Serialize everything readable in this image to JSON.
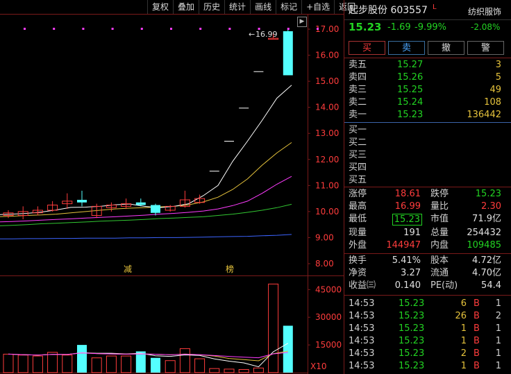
{
  "toolbar": [
    "复权",
    "叠加",
    "历史",
    "统计",
    "画线",
    "标记",
    "+自选",
    "返回"
  ],
  "chart": {
    "high_label": "16.99",
    "price_ticks": [
      "17.00",
      "16.00",
      "15.00",
      "14.00",
      "13.00",
      "12.00",
      "11.00",
      "10.00",
      "9.00",
      "8.00"
    ],
    "vol_ticks": [
      "45000",
      "30000",
      "15000"
    ],
    "vol_unit": "X10",
    "markers": [
      "减",
      "榜"
    ],
    "colors": {
      "up": "#ff3c3c",
      "down": "#54ffff",
      "ma5": "#ffffff",
      "ma10": "#e6c33c",
      "ma20": "#ff3cff",
      "ma30": "#32c832",
      "ma60": "#3c64ff"
    }
  },
  "header": {
    "name": "起步股份 603557",
    "flag": "L",
    "industry": "纺织服饰",
    "industry_change": "-2.08%",
    "price": "15.23",
    "change": "-1.69",
    "pct": "-9.99%"
  },
  "buttons": {
    "buy": "买",
    "sell": "卖",
    "cancel": "撤",
    "alert": "警"
  },
  "asks": [
    {
      "label": "卖五",
      "price": "15.27",
      "vol": "3"
    },
    {
      "label": "卖四",
      "price": "15.26",
      "vol": "5"
    },
    {
      "label": "卖三",
      "price": "15.25",
      "vol": "49"
    },
    {
      "label": "卖二",
      "price": "15.24",
      "vol": "108"
    },
    {
      "label": "卖一",
      "price": "15.23",
      "vol": "136442"
    }
  ],
  "bids": [
    {
      "label": "买一"
    },
    {
      "label": "买二"
    },
    {
      "label": "买三"
    },
    {
      "label": "买四"
    },
    {
      "label": "买五"
    }
  ],
  "quote": {
    "zt_l": "涨停",
    "zt_v": "18.61",
    "dt_l": "跌停",
    "dt_v": "15.23",
    "hi_l": "最高",
    "hi_v": "16.99",
    "lb_l": "量比",
    "lb_v": "2.30",
    "lo_l": "最低",
    "lo_v": "15.23",
    "sz_l": "市值",
    "sz_v": "71.9亿",
    "xl_l": "现量",
    "xl_v": "191",
    "zl_l": "总量",
    "zl_v": "254432",
    "wp_l": "外盘",
    "wp_v": "144947",
    "np_l": "内盘",
    "np_v": "109485"
  },
  "fin": {
    "hs_l": "换手",
    "hs_v": "5.41%",
    "gb_l": "股本",
    "gb_v": "4.72亿",
    "jz_l": "净资",
    "jz_v": "3.27",
    "lt_l": "流通",
    "lt_v": "4.70亿",
    "sy_l": "收益㈢",
    "sy_v": "0.140",
    "pe_l": "PE(动)",
    "pe_v": "54.4"
  },
  "ticks": [
    {
      "time": "14:53",
      "price": "15.23",
      "vol": "6",
      "bs": "B",
      "n": "1"
    },
    {
      "time": "14:53",
      "price": "15.23",
      "vol": "26",
      "bs": "B",
      "n": "2"
    },
    {
      "time": "14:53",
      "price": "15.23",
      "vol": "1",
      "bs": "B",
      "n": "1"
    },
    {
      "time": "14:53",
      "price": "15.23",
      "vol": "1",
      "bs": "B",
      "n": "1"
    },
    {
      "time": "14:53",
      "price": "15.23",
      "vol": "2",
      "bs": "B",
      "n": "1"
    },
    {
      "time": "14:53",
      "price": "15.23",
      "vol": "1",
      "bs": "B",
      "n": "1"
    }
  ],
  "chart_data": {
    "type": "candlestick",
    "ylim": [
      8,
      17.5
    ],
    "candles": [
      {
        "o": 9.85,
        "c": 9.95,
        "h": 10.05,
        "l": 9.75,
        "v": 10000
      },
      {
        "o": 9.85,
        "c": 10.0,
        "h": 10.2,
        "l": 9.7,
        "v": 9500
      },
      {
        "o": 9.95,
        "c": 10.05,
        "h": 10.2,
        "l": 9.85,
        "v": 9000
      },
      {
        "o": 10.05,
        "c": 10.25,
        "h": 10.4,
        "l": 10.0,
        "v": 11000
      },
      {
        "o": 10.3,
        "c": 10.4,
        "h": 10.7,
        "l": 10.1,
        "v": 9500
      },
      {
        "o": 10.45,
        "c": 10.35,
        "h": 10.8,
        "l": 10.2,
        "v": 15000
      },
      {
        "o": 9.85,
        "c": 10.2,
        "h": 10.3,
        "l": 9.75,
        "v": 8000
      },
      {
        "o": 10.15,
        "c": 10.25,
        "h": 10.35,
        "l": 10.0,
        "v": 9000
      },
      {
        "o": 10.2,
        "c": 10.3,
        "h": 10.5,
        "l": 10.1,
        "v": 9000
      },
      {
        "o": 10.35,
        "c": 10.25,
        "h": 10.5,
        "l": 10.2,
        "v": 11500
      },
      {
        "o": 10.25,
        "c": 9.95,
        "h": 10.3,
        "l": 9.85,
        "v": 8000
      },
      {
        "o": 10.05,
        "c": 10.2,
        "h": 10.25,
        "l": 10.0,
        "v": 6500
      },
      {
        "o": 10.2,
        "c": 10.45,
        "h": 10.8,
        "l": 10.15,
        "v": 13000
      },
      {
        "o": 10.35,
        "c": 10.5,
        "h": 10.65,
        "l": 10.3,
        "v": 7500
      },
      {
        "o": 11.55,
        "c": 11.55,
        "h": 11.55,
        "l": 11.55,
        "v": 2200
      },
      {
        "o": 12.7,
        "c": 12.7,
        "h": 12.7,
        "l": 12.7,
        "v": 1900
      },
      {
        "o": 13.97,
        "c": 13.97,
        "h": 13.97,
        "l": 13.97,
        "v": 1700
      },
      {
        "o": 15.37,
        "c": 15.37,
        "h": 15.37,
        "l": 15.37,
        "v": 2500
      },
      {
        "o": 16.65,
        "c": 16.65,
        "h": 16.85,
        "l": 16.65,
        "v": 48000
      },
      {
        "o": 16.92,
        "c": 15.23,
        "h": 16.99,
        "l": 15.23,
        "v": 25400
      }
    ],
    "ma5": [
      9.88,
      9.9,
      9.93,
      9.98,
      10.06,
      10.16,
      10.17,
      10.2,
      10.26,
      10.29,
      10.2,
      10.15,
      10.2,
      10.3,
      10.61,
      11.0,
      11.93,
      12.7,
      13.5,
      14.35,
      14.85
    ],
    "ma10": [
      9.8,
      9.82,
      9.85,
      9.87,
      9.9,
      9.95,
      10.0,
      10.05,
      10.1,
      10.13,
      10.15,
      10.18,
      10.2,
      10.26,
      10.37,
      10.55,
      10.85,
      11.25,
      11.78,
      12.25,
      12.65
    ],
    "ma20": [
      9.6,
      9.62,
      9.64,
      9.67,
      9.7,
      9.72,
      9.75,
      9.78,
      9.8,
      9.83,
      9.86,
      9.9,
      9.93,
      9.97,
      10.02,
      10.1,
      10.23,
      10.4,
      10.7,
      11.05,
      11.35
    ],
    "ma30": [
      9.45,
      9.47,
      9.5,
      9.53,
      9.55,
      9.58,
      9.6,
      9.63,
      9.65,
      9.67,
      9.7,
      9.73,
      9.75,
      9.78,
      9.8,
      9.85,
      9.9,
      9.97,
      10.05,
      10.15,
      10.28
    ],
    "ma60": [
      8.95,
      8.95,
      8.96,
      8.96,
      8.97,
      8.97,
      8.98,
      8.98,
      8.98,
      8.99,
      8.99,
      9.0,
      9.0,
      9.01,
      9.02,
      9.03,
      9.04,
      9.05,
      9.07,
      9.09,
      9.12
    ],
    "vol_ylim": [
      0,
      50000
    ]
  }
}
